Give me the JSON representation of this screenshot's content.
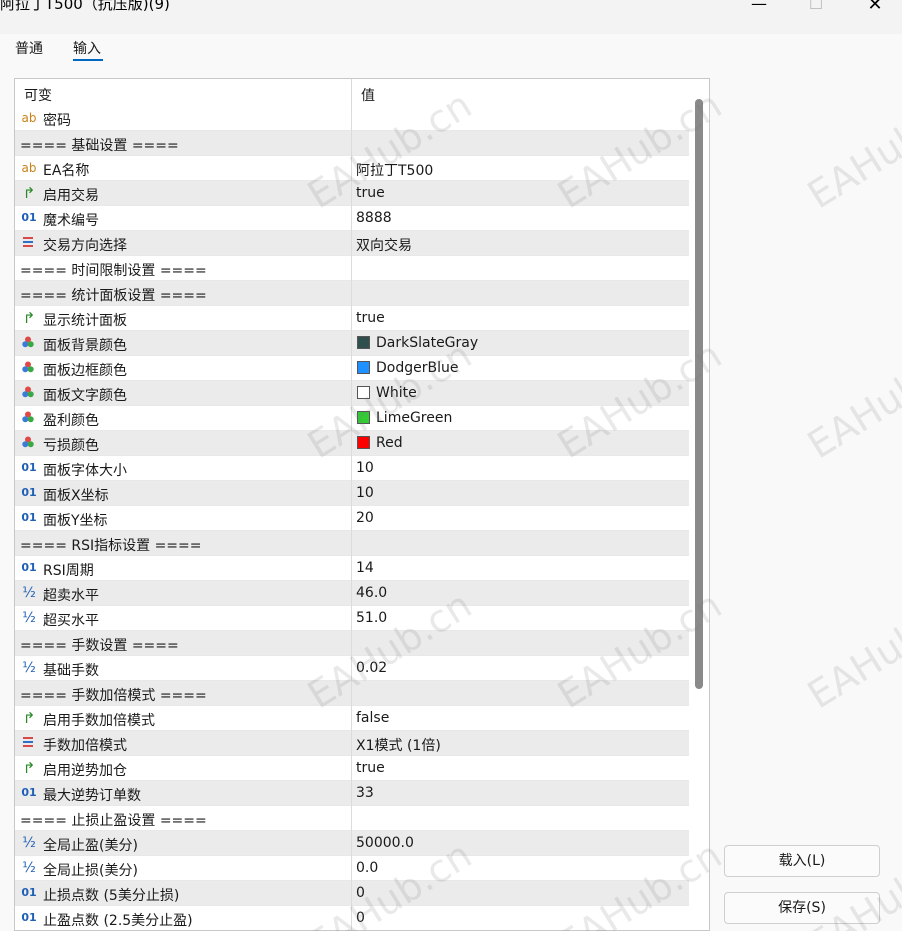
{
  "window": {
    "title": "阿拉丁T500（抗压版)(9)",
    "minimize": "—",
    "maximize": "☐",
    "close": "✕"
  },
  "tabs": [
    {
      "label": "普通"
    },
    {
      "label": "输入",
      "active": true
    }
  ],
  "table": {
    "headers": {
      "variable": "可变",
      "value": "值"
    },
    "rows": [
      {
        "type": "string",
        "name": "密码",
        "value": ""
      },
      {
        "type": "section",
        "name": "==== 基础设置 ====",
        "value": ""
      },
      {
        "type": "string",
        "name": "EA名称",
        "value": "阿拉丁T500"
      },
      {
        "type": "bool",
        "name": "启用交易",
        "value": "true"
      },
      {
        "type": "int",
        "name": "魔术编号",
        "value": "8888"
      },
      {
        "type": "enum",
        "name": "交易方向选择",
        "value": "双向交易"
      },
      {
        "type": "section",
        "name": "==== 时间限制设置 ====",
        "value": ""
      },
      {
        "type": "section",
        "name": "==== 统计面板设置 ====",
        "value": ""
      },
      {
        "type": "bool",
        "name": "显示统计面板",
        "value": "true"
      },
      {
        "type": "color",
        "name": "面板背景颜色",
        "value": "DarkSlateGray",
        "color": "#2f4f4f"
      },
      {
        "type": "color",
        "name": "面板边框颜色",
        "value": "DodgerBlue",
        "color": "#1e90ff"
      },
      {
        "type": "color",
        "name": "面板文字颜色",
        "value": "White",
        "color": "#ffffff"
      },
      {
        "type": "color",
        "name": "盈利颜色",
        "value": "LimeGreen",
        "color": "#32cd32"
      },
      {
        "type": "color",
        "name": "亏损颜色",
        "value": "Red",
        "color": "#ff0000"
      },
      {
        "type": "int",
        "name": "面板字体大小",
        "value": "10"
      },
      {
        "type": "int",
        "name": "面板X坐标",
        "value": "10"
      },
      {
        "type": "int",
        "name": "面板Y坐标",
        "value": "20"
      },
      {
        "type": "section",
        "name": "==== RSI指标设置 ====",
        "value": ""
      },
      {
        "type": "int",
        "name": "RSI周期",
        "value": "14"
      },
      {
        "type": "double",
        "name": "超卖水平",
        "value": "46.0"
      },
      {
        "type": "double",
        "name": "超买水平",
        "value": "51.0"
      },
      {
        "type": "section",
        "name": "==== 手数设置 ====",
        "value": ""
      },
      {
        "type": "double",
        "name": "基础手数",
        "value": "0.02"
      },
      {
        "type": "section",
        "name": "==== 手数加倍模式 ====",
        "value": ""
      },
      {
        "type": "bool",
        "name": "启用手数加倍模式",
        "value": "false"
      },
      {
        "type": "enum",
        "name": "手数加倍模式",
        "value": "X1模式 (1倍)"
      },
      {
        "type": "bool",
        "name": "启用逆势加仓",
        "value": "true"
      },
      {
        "type": "int",
        "name": "最大逆势订单数",
        "value": "33"
      },
      {
        "type": "section",
        "name": "==== 止损止盈设置 ====",
        "value": ""
      },
      {
        "type": "double",
        "name": "全局止盈(美分)",
        "value": "50000.0"
      },
      {
        "type": "double",
        "name": "全局止损(美分)",
        "value": "0.0"
      },
      {
        "type": "int",
        "name": "止损点数 (5美分止损)",
        "value": "0"
      },
      {
        "type": "int",
        "name": "止盈点数 (2.5美分止盈)",
        "value": "0"
      }
    ]
  },
  "buttons": {
    "load": "载入(L)",
    "save": "保存(S)"
  },
  "watermark": "EAHub.cn"
}
